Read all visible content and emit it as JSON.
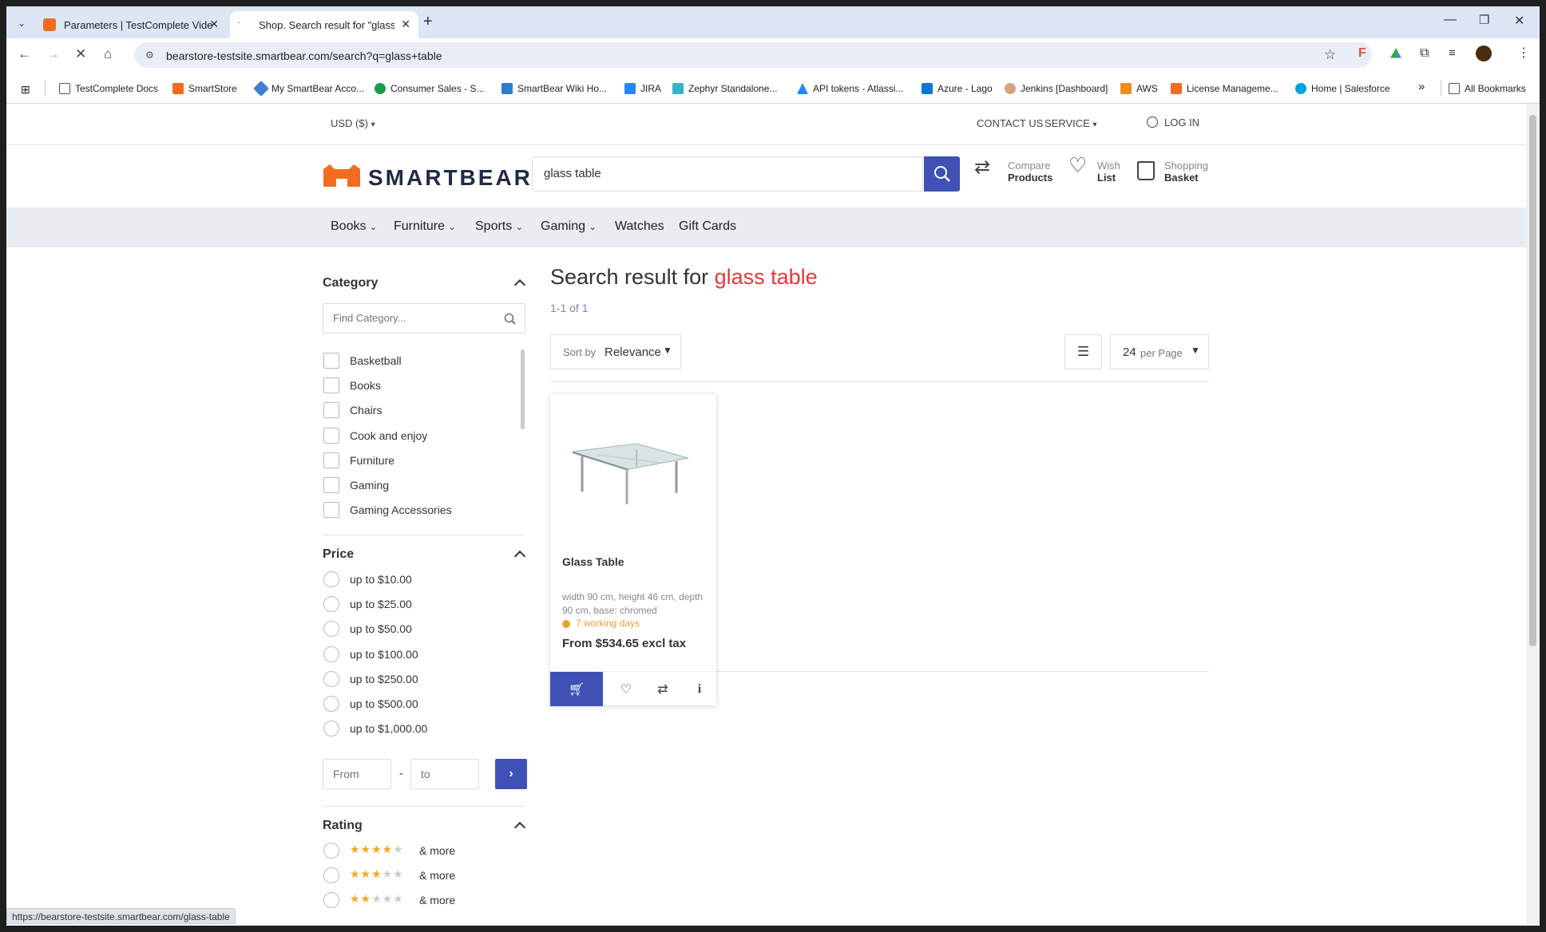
{
  "browser": {
    "tabs": [
      {
        "title": "Parameters | TestComplete Vide",
        "active": false
      },
      {
        "title": "Shop. Search result for \"glass ta",
        "active": true
      }
    ],
    "new_tab": "+",
    "address": "bearstore-testsite.smartbear.com/search?q=glass+table",
    "bookmarks": [
      "TestComplete Docs",
      "SmartStore",
      "My SmartBear Acco...",
      "Consumer Sales - S...",
      "SmartBear Wiki Ho...",
      "JIRA",
      "Zephyr Standalone...",
      "API tokens - Atlassi...",
      "Azure - Lago",
      "Jenkins [Dashboard]",
      "AWS",
      "License Manageme...",
      "Home | Salesforce"
    ],
    "more_bookmarks": "»",
    "all_bookmarks": "All Bookmarks",
    "status_url": "https://bearstore-testsite.smartbear.com/glass-table"
  },
  "site": {
    "currency": "USD  ($)",
    "contact": "CONTACT US",
    "service": "SERVICE",
    "login": "LOG IN",
    "logo_text": "SMARTBEAR",
    "search_value": "glass table",
    "compare": {
      "line1": "Compare",
      "line2": "Products"
    },
    "wish": {
      "line1": "Wish",
      "line2": "List"
    },
    "basket": {
      "line1": "Shopping",
      "line2": "Basket"
    },
    "menu": [
      "Books",
      "Furniture",
      "Sports",
      "Gaming",
      "Watches",
      "Gift Cards"
    ]
  },
  "filters": {
    "category_title": "Category",
    "category_placeholder": "Find Category...",
    "categories": [
      "Basketball",
      "Books",
      "Chairs",
      "Cook and enjoy",
      "Furniture",
      "Gaming",
      "Gaming Accessories"
    ],
    "price_title": "Price",
    "prices": [
      "up to $10.00",
      "up to $25.00",
      "up to $50.00",
      "up to $100.00",
      "up to $250.00",
      "up to $500.00",
      "up to $1,000.00"
    ],
    "from_placeholder": "From",
    "to_placeholder": "to",
    "range_sep": "-",
    "rating_title": "Rating",
    "ratings": [
      {
        "stars": 4,
        "label": "& more"
      },
      {
        "stars": 3,
        "label": "& more"
      },
      {
        "stars": 2,
        "label": "& more"
      }
    ]
  },
  "results": {
    "heading": "Search result for",
    "query": "glass table",
    "count": "1-1 of 1",
    "sort_prefix": "Sort by",
    "sort_value": "Relevance",
    "per_page_value": "24",
    "per_page_suffix": "per Page",
    "product": {
      "name": "Glass Table",
      "desc": "width 90 cm, height 46 cm, depth 90 cm, base: chromed",
      "delivery": "7 working days",
      "price": "From $534.65 excl tax"
    }
  },
  "colors": {
    "accent": "#3f51b5",
    "query": "#e53935",
    "delivery": "#f0a030",
    "logo": "#f26b21"
  }
}
